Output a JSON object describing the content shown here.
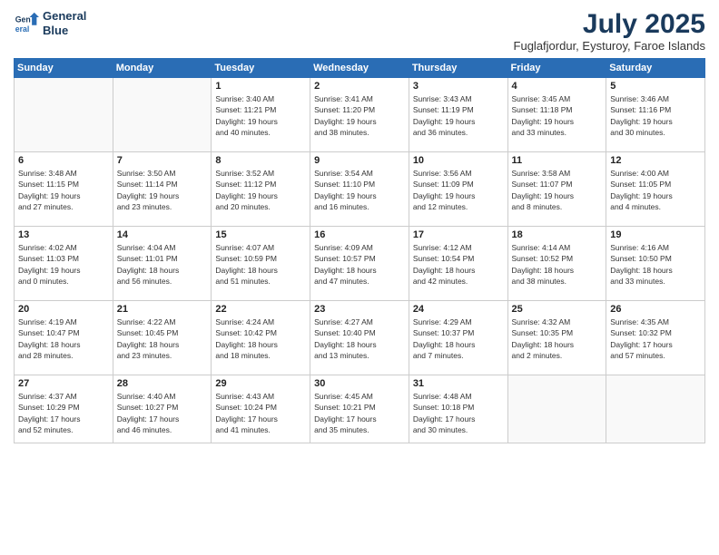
{
  "header": {
    "logo_line1": "General",
    "logo_line2": "Blue",
    "month": "July 2025",
    "location": "Fuglafjordur, Eysturoy, Faroe Islands"
  },
  "days_of_week": [
    "Sunday",
    "Monday",
    "Tuesday",
    "Wednesday",
    "Thursday",
    "Friday",
    "Saturday"
  ],
  "weeks": [
    [
      {
        "day": "",
        "detail": ""
      },
      {
        "day": "",
        "detail": ""
      },
      {
        "day": "1",
        "detail": "Sunrise: 3:40 AM\nSunset: 11:21 PM\nDaylight: 19 hours\nand 40 minutes."
      },
      {
        "day": "2",
        "detail": "Sunrise: 3:41 AM\nSunset: 11:20 PM\nDaylight: 19 hours\nand 38 minutes."
      },
      {
        "day": "3",
        "detail": "Sunrise: 3:43 AM\nSunset: 11:19 PM\nDaylight: 19 hours\nand 36 minutes."
      },
      {
        "day": "4",
        "detail": "Sunrise: 3:45 AM\nSunset: 11:18 PM\nDaylight: 19 hours\nand 33 minutes."
      },
      {
        "day": "5",
        "detail": "Sunrise: 3:46 AM\nSunset: 11:16 PM\nDaylight: 19 hours\nand 30 minutes."
      }
    ],
    [
      {
        "day": "6",
        "detail": "Sunrise: 3:48 AM\nSunset: 11:15 PM\nDaylight: 19 hours\nand 27 minutes."
      },
      {
        "day": "7",
        "detail": "Sunrise: 3:50 AM\nSunset: 11:14 PM\nDaylight: 19 hours\nand 23 minutes."
      },
      {
        "day": "8",
        "detail": "Sunrise: 3:52 AM\nSunset: 11:12 PM\nDaylight: 19 hours\nand 20 minutes."
      },
      {
        "day": "9",
        "detail": "Sunrise: 3:54 AM\nSunset: 11:10 PM\nDaylight: 19 hours\nand 16 minutes."
      },
      {
        "day": "10",
        "detail": "Sunrise: 3:56 AM\nSunset: 11:09 PM\nDaylight: 19 hours\nand 12 minutes."
      },
      {
        "day": "11",
        "detail": "Sunrise: 3:58 AM\nSunset: 11:07 PM\nDaylight: 19 hours\nand 8 minutes."
      },
      {
        "day": "12",
        "detail": "Sunrise: 4:00 AM\nSunset: 11:05 PM\nDaylight: 19 hours\nand 4 minutes."
      }
    ],
    [
      {
        "day": "13",
        "detail": "Sunrise: 4:02 AM\nSunset: 11:03 PM\nDaylight: 19 hours\nand 0 minutes."
      },
      {
        "day": "14",
        "detail": "Sunrise: 4:04 AM\nSunset: 11:01 PM\nDaylight: 18 hours\nand 56 minutes."
      },
      {
        "day": "15",
        "detail": "Sunrise: 4:07 AM\nSunset: 10:59 PM\nDaylight: 18 hours\nand 51 minutes."
      },
      {
        "day": "16",
        "detail": "Sunrise: 4:09 AM\nSunset: 10:57 PM\nDaylight: 18 hours\nand 47 minutes."
      },
      {
        "day": "17",
        "detail": "Sunrise: 4:12 AM\nSunset: 10:54 PM\nDaylight: 18 hours\nand 42 minutes."
      },
      {
        "day": "18",
        "detail": "Sunrise: 4:14 AM\nSunset: 10:52 PM\nDaylight: 18 hours\nand 38 minutes."
      },
      {
        "day": "19",
        "detail": "Sunrise: 4:16 AM\nSunset: 10:50 PM\nDaylight: 18 hours\nand 33 minutes."
      }
    ],
    [
      {
        "day": "20",
        "detail": "Sunrise: 4:19 AM\nSunset: 10:47 PM\nDaylight: 18 hours\nand 28 minutes."
      },
      {
        "day": "21",
        "detail": "Sunrise: 4:22 AM\nSunset: 10:45 PM\nDaylight: 18 hours\nand 23 minutes."
      },
      {
        "day": "22",
        "detail": "Sunrise: 4:24 AM\nSunset: 10:42 PM\nDaylight: 18 hours\nand 18 minutes."
      },
      {
        "day": "23",
        "detail": "Sunrise: 4:27 AM\nSunset: 10:40 PM\nDaylight: 18 hours\nand 13 minutes."
      },
      {
        "day": "24",
        "detail": "Sunrise: 4:29 AM\nSunset: 10:37 PM\nDaylight: 18 hours\nand 7 minutes."
      },
      {
        "day": "25",
        "detail": "Sunrise: 4:32 AM\nSunset: 10:35 PM\nDaylight: 18 hours\nand 2 minutes."
      },
      {
        "day": "26",
        "detail": "Sunrise: 4:35 AM\nSunset: 10:32 PM\nDaylight: 17 hours\nand 57 minutes."
      }
    ],
    [
      {
        "day": "27",
        "detail": "Sunrise: 4:37 AM\nSunset: 10:29 PM\nDaylight: 17 hours\nand 52 minutes."
      },
      {
        "day": "28",
        "detail": "Sunrise: 4:40 AM\nSunset: 10:27 PM\nDaylight: 17 hours\nand 46 minutes."
      },
      {
        "day": "29",
        "detail": "Sunrise: 4:43 AM\nSunset: 10:24 PM\nDaylight: 17 hours\nand 41 minutes."
      },
      {
        "day": "30",
        "detail": "Sunrise: 4:45 AM\nSunset: 10:21 PM\nDaylight: 17 hours\nand 35 minutes."
      },
      {
        "day": "31",
        "detail": "Sunrise: 4:48 AM\nSunset: 10:18 PM\nDaylight: 17 hours\nand 30 minutes."
      },
      {
        "day": "",
        "detail": ""
      },
      {
        "day": "",
        "detail": ""
      }
    ]
  ]
}
